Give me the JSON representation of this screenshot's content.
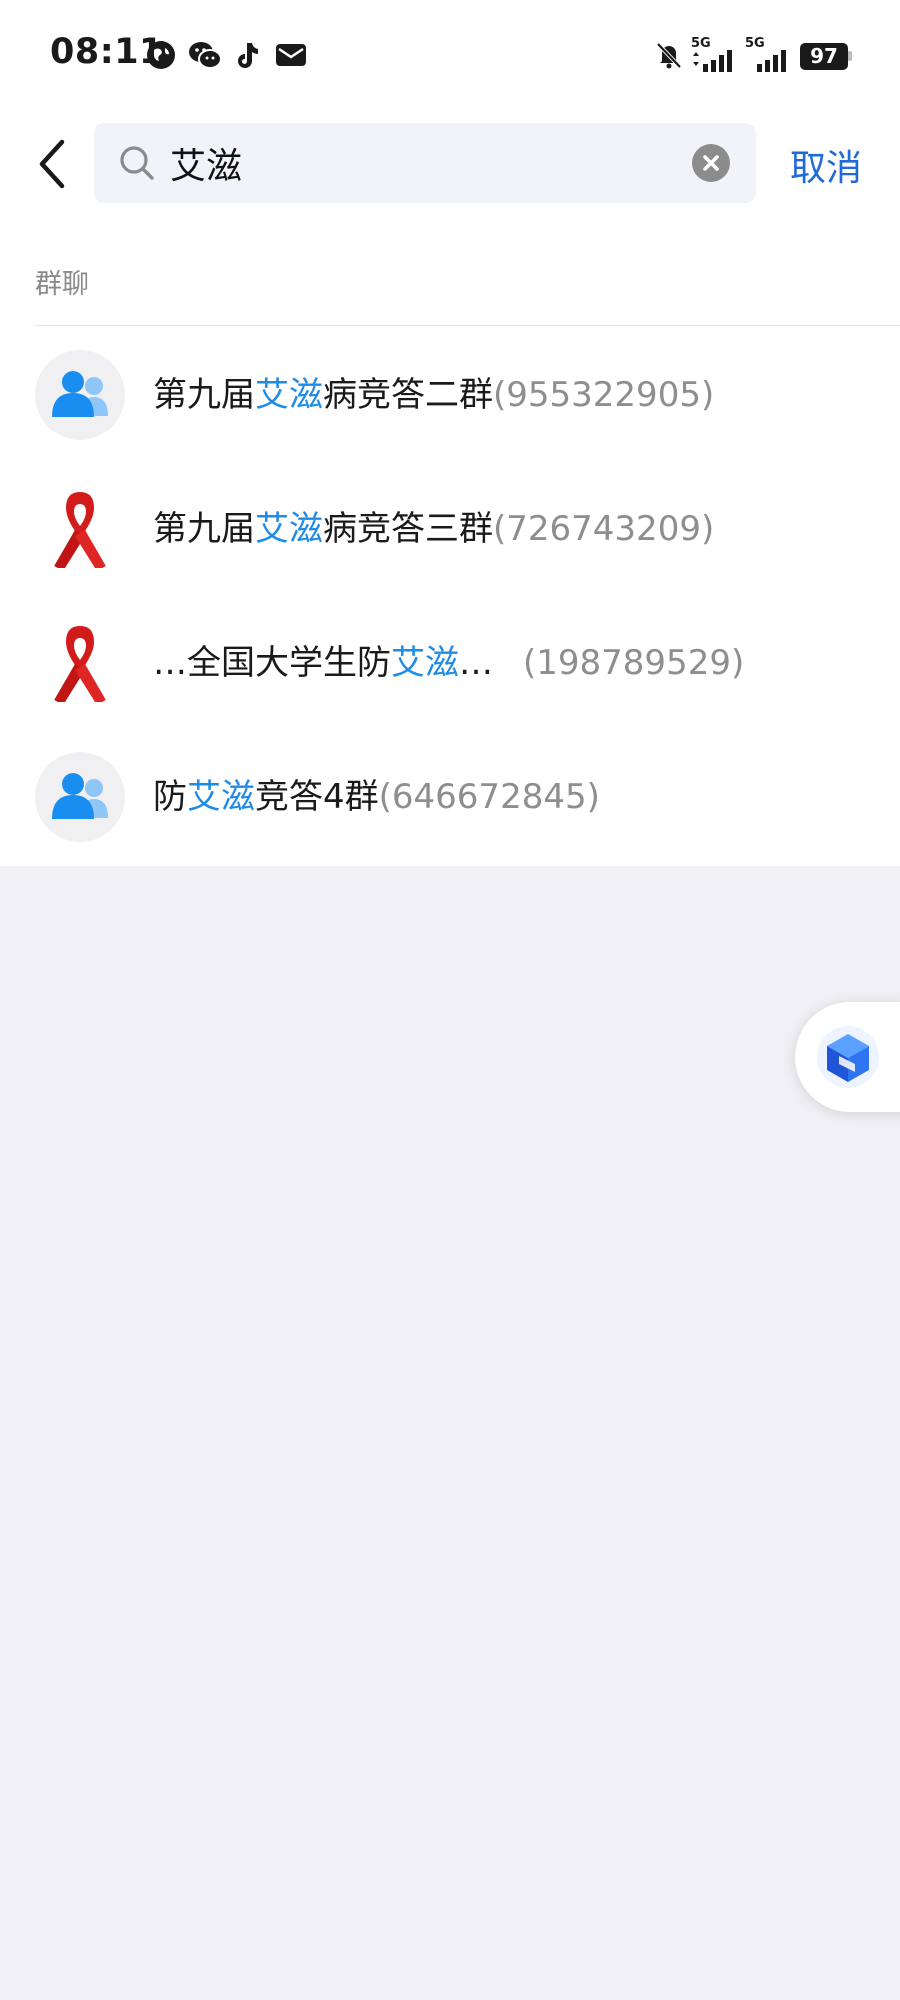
{
  "status_bar": {
    "time": "08:11",
    "icons": [
      "globe-icon",
      "wechat-icon",
      "tiktok-icon",
      "mail-icon",
      "mute-bell-icon",
      "signal-5g-icon",
      "signal-5g-icon",
      "battery-icon"
    ],
    "sim1_label": "5G",
    "sim2_label": "5G",
    "battery_level": "97"
  },
  "search": {
    "query": "艾滋",
    "cancel_label": "取消"
  },
  "section": {
    "title": "群聊"
  },
  "results": [
    {
      "avatar": "group-icon",
      "pre": "第九届",
      "hl": "艾滋",
      "post": "病竞答二群",
      "number": "(955322905)"
    },
    {
      "avatar": "red-ribbon",
      "pre": "第九届",
      "hl": "艾滋",
      "post": "病竞答三群",
      "number": "(726743209)"
    },
    {
      "avatar": "red-ribbon",
      "pre": "…全国大学生防",
      "hl": "艾滋",
      "post": "…",
      "number": "(198789529)"
    },
    {
      "avatar": "group-icon",
      "pre": "防",
      "hl": "艾滋",
      "post": "竞答4群",
      "number": "(646672845)"
    }
  ],
  "colors": {
    "highlight": "#1e8be6",
    "accent": "#1f6ad6",
    "background": "#f0f0f5"
  }
}
